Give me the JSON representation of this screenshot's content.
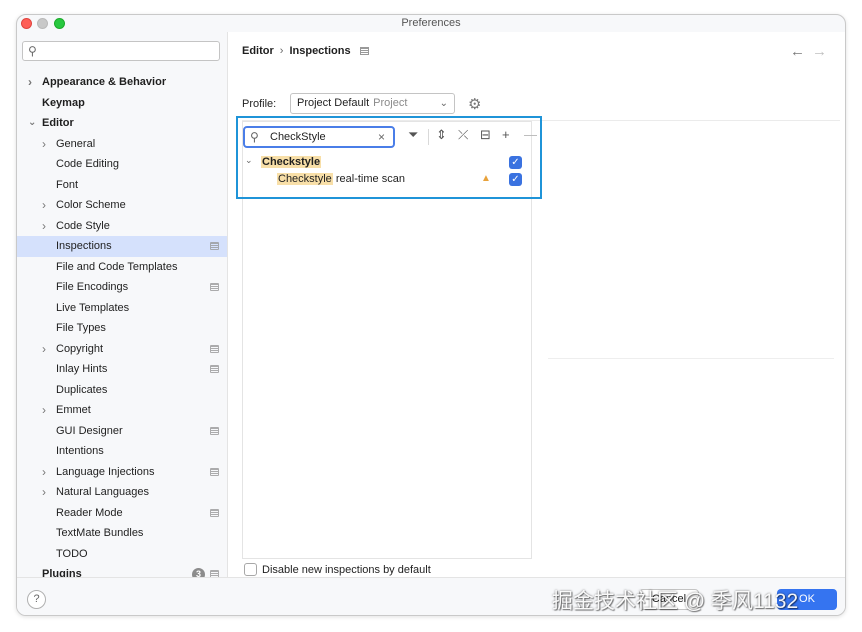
{
  "window": {
    "title": "Preferences"
  },
  "sidebar": {
    "search_placeholder": "",
    "items": [
      {
        "label": "Appearance & Behavior",
        "level": 0,
        "bold": true,
        "arrow": true,
        "doc": false
      },
      {
        "label": "Keymap",
        "level": 0,
        "bold": true,
        "arrow": false,
        "doc": false
      },
      {
        "label": "Editor",
        "level": 0,
        "bold": true,
        "arrow": true,
        "expanded": true,
        "doc": false
      },
      {
        "label": "General",
        "level": 1,
        "arrow": true,
        "doc": false
      },
      {
        "label": "Code Editing",
        "level": 1,
        "arrow": false,
        "doc": false
      },
      {
        "label": "Font",
        "level": 1,
        "arrow": false,
        "doc": false
      },
      {
        "label": "Color Scheme",
        "level": 1,
        "arrow": true,
        "doc": false
      },
      {
        "label": "Code Style",
        "level": 1,
        "arrow": true,
        "doc": false
      },
      {
        "label": "Inspections",
        "level": 1,
        "arrow": false,
        "doc": true,
        "selected": true
      },
      {
        "label": "File and Code Templates",
        "level": 1,
        "arrow": false,
        "doc": false
      },
      {
        "label": "File Encodings",
        "level": 1,
        "arrow": false,
        "doc": true
      },
      {
        "label": "Live Templates",
        "level": 1,
        "arrow": false,
        "doc": false
      },
      {
        "label": "File Types",
        "level": 1,
        "arrow": false,
        "doc": false
      },
      {
        "label": "Copyright",
        "level": 1,
        "arrow": true,
        "doc": true
      },
      {
        "label": "Inlay Hints",
        "level": 1,
        "arrow": false,
        "doc": true
      },
      {
        "label": "Duplicates",
        "level": 1,
        "arrow": false,
        "doc": false
      },
      {
        "label": "Emmet",
        "level": 1,
        "arrow": true,
        "doc": false
      },
      {
        "label": "GUI Designer",
        "level": 1,
        "arrow": false,
        "doc": true
      },
      {
        "label": "Intentions",
        "level": 1,
        "arrow": false,
        "doc": false
      },
      {
        "label": "Language Injections",
        "level": 1,
        "arrow": true,
        "doc": true
      },
      {
        "label": "Natural Languages",
        "level": 1,
        "arrow": true,
        "doc": false
      },
      {
        "label": "Reader Mode",
        "level": 1,
        "arrow": false,
        "doc": true
      },
      {
        "label": "TextMate Bundles",
        "level": 1,
        "arrow": false,
        "doc": false
      },
      {
        "label": "TODO",
        "level": 1,
        "arrow": false,
        "doc": false
      },
      {
        "label": "Plugins",
        "level": 0,
        "bold": true,
        "arrow": false,
        "doc": true,
        "badge": "3"
      }
    ]
  },
  "main": {
    "breadcrumb": [
      "Editor",
      "Inspections"
    ],
    "breadcrumb_sep": "›",
    "profile": {
      "label": "Profile:",
      "value": "Project Default",
      "scope": "Project"
    },
    "filter": {
      "value": "CheckStyle"
    },
    "tree": {
      "group": {
        "match": "Checkstyle",
        "checked": true
      },
      "item": {
        "match": "Checkstyle",
        "rest": " real-time scan",
        "checked": true,
        "warning": true
      }
    },
    "bottom_checkbox": {
      "label": "Disable new inspections by default",
      "checked": false
    }
  },
  "footer": {
    "help": "?",
    "cancel": "Cancel",
    "ok": "OK"
  },
  "watermark": "掘金技术社区 @ 季风1132",
  "colors": {
    "accent": "#3574f0",
    "selection": "#d5e1fc",
    "highlight_box": "#1f94d8",
    "match_highlight": "#f8dfa8"
  }
}
